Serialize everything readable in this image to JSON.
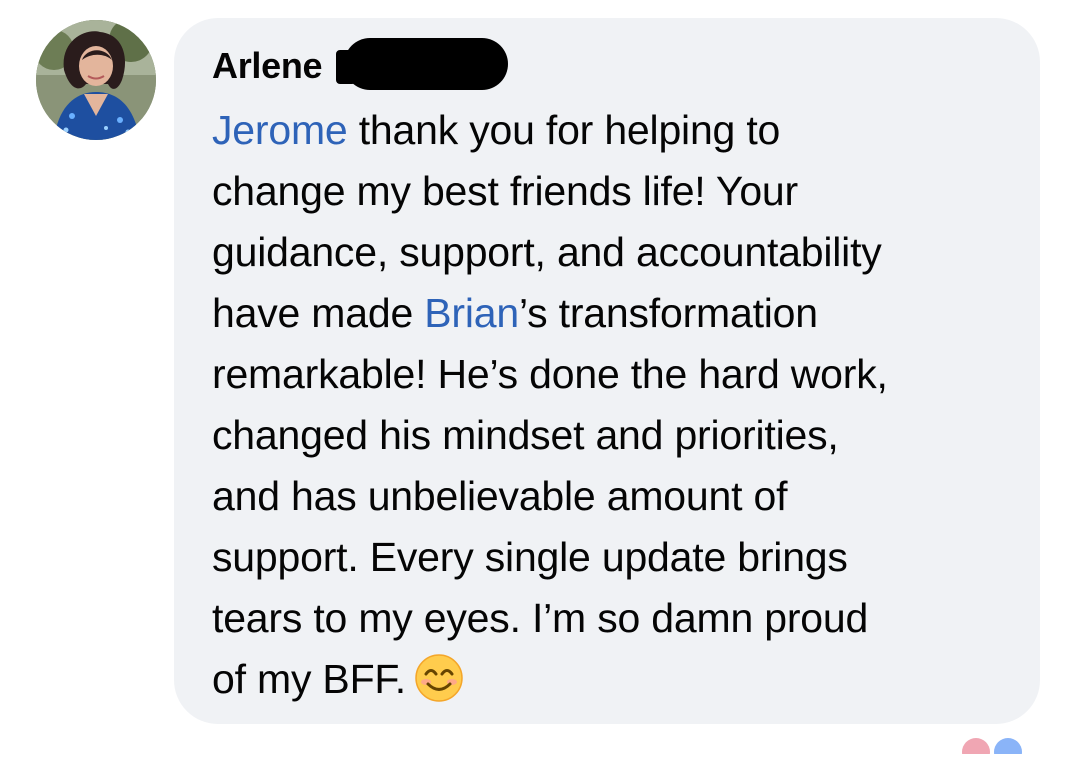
{
  "comment": {
    "author_first_name": "Arlene",
    "author_name_redacted": true,
    "lines": [
      [
        {
          "text": "Jerome",
          "mention": true
        },
        {
          "text": " thank you for helping to"
        }
      ],
      [
        {
          "text": "change my best friends life! Your"
        }
      ],
      [
        {
          "text": "guidance, support, and accountability"
        }
      ],
      [
        {
          "text": "have made "
        },
        {
          "text": "Brian",
          "mention": true
        },
        {
          "text": "’s transformation"
        }
      ],
      [
        {
          "text": "remarkable! He’s done the hard work,"
        }
      ],
      [
        {
          "text": "changed his mindset and priorities,"
        }
      ],
      [
        {
          "text": "and has unbelievable amount of"
        }
      ],
      [
        {
          "text": "support. Every single update brings"
        }
      ],
      [
        {
          "text": "tears to my eyes. I’m so damn proud"
        }
      ],
      [
        {
          "text": "of my BFF."
        }
      ]
    ],
    "trailing_emoji": "smiling-face-with-smiling-eyes"
  },
  "colors": {
    "bubble_background": "#f0f2f5",
    "mention_link": "#2e63b8",
    "text": "#050505"
  },
  "icons": {
    "avatar": "profile-photo",
    "reactions": "reaction-icons-partially-visible"
  }
}
